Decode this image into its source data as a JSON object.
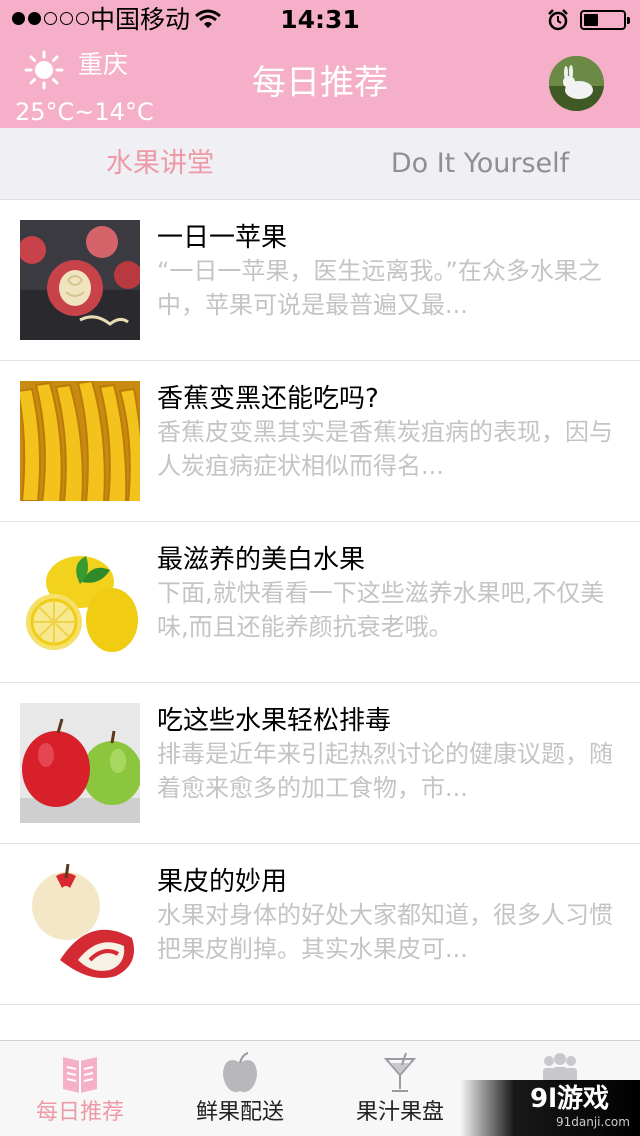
{
  "status_bar": {
    "carrier": "中国移动",
    "time": "14:31"
  },
  "header": {
    "city": "重庆",
    "temperature": "25°C~14°C",
    "title": "每日推荐"
  },
  "tabs": [
    {
      "label": "水果讲堂",
      "selected": true
    },
    {
      "label": "Do It Yourself",
      "selected": false
    }
  ],
  "articles": [
    {
      "title": "一日一苹果",
      "desc": "“一日一苹果，医生远离我。”在众多水果之中，苹果可说是最普遍又最...",
      "thumb": "carved-apple"
    },
    {
      "title": "香蕉变黑还能吃吗?",
      "desc": "香蕉皮变黑其实是香蕉炭疽病的表现，因与人炭疽病症状相似而得名...",
      "thumb": "bananas"
    },
    {
      "title": "最滋养的美白水果",
      "desc": "下面,就快看看一下这些滋养水果吧,不仅美味,而且还能养颜抗衰老哦。",
      "thumb": "lemons"
    },
    {
      "title": "吃这些水果轻松排毒",
      "desc": "排毒是近年来引起热烈讨论的健康议题，随着愈来愈多的加工食物，市...",
      "thumb": "red-green-apples"
    },
    {
      "title": "果皮的妙用",
      "desc": "水果对身体的好处大家都知道，很多人习惯把果皮削掉。其实水果皮可...",
      "thumb": "peeled-apple"
    }
  ],
  "tabbar": [
    {
      "label": "每日推荐",
      "icon": "book-icon",
      "active": true
    },
    {
      "label": "鲜果配送",
      "icon": "apple-icon",
      "active": false
    },
    {
      "label": "果汁果盘",
      "icon": "cocktail-glass-icon",
      "active": false
    },
    {
      "label": "",
      "icon": "people-icon",
      "active": false
    }
  ],
  "watermark": {
    "main": "9l游戏",
    "sub": "91danji.com"
  },
  "colors": {
    "accent": "#f5afc8",
    "active_tab": "#ee9aa6",
    "desc_gray": "#c4c4c4"
  }
}
